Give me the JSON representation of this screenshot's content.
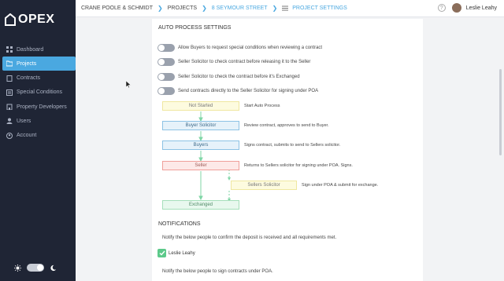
{
  "app": {
    "logo_text": "OPEX"
  },
  "sidebar": {
    "items": [
      {
        "label": "Dashboard",
        "icon": "grid-icon"
      },
      {
        "label": "Projects",
        "icon": "folder-icon",
        "active": true
      },
      {
        "label": "Contracts",
        "icon": "document-icon"
      },
      {
        "label": "Special Conditions",
        "icon": "list-icon"
      },
      {
        "label": "Property Developers",
        "icon": "building-icon"
      },
      {
        "label": "Users",
        "icon": "user-icon"
      },
      {
        "label": "Account",
        "icon": "account-icon"
      }
    ],
    "theme_toggle": {
      "light_icon": "sun-icon",
      "dark_icon": "moon-icon",
      "state": "on"
    }
  },
  "breadcrumb": {
    "items": [
      "CRANE POOLE & SCHMIDT",
      "PROJECTS",
      "8 SEYMOUR STREET",
      "PROJECT SETTINGS"
    ]
  },
  "user": {
    "name": "Leslie Leahy",
    "help_label": "?"
  },
  "auto_process": {
    "title": "AUTO PROCESS SETTINGS",
    "toggles": [
      {
        "label": "Allow Buyers to request special conditions when reviewing a contract",
        "on": false
      },
      {
        "label": "Seller Solicitor to check contract before releasing it to the Seller",
        "on": false
      },
      {
        "label": "Seller Solicitor to check the contract before it's Exchanged",
        "on": false
      },
      {
        "label": "Send contracts directly to the Seller Solicitor for signing under POA",
        "on": false
      }
    ]
  },
  "flow": {
    "steps": [
      {
        "label": "Not Started",
        "desc": "Start Auto Process",
        "color": "#fdfbdf"
      },
      {
        "label": "Buyer Solicitor",
        "desc": "Review contract, approves to send to Buyer.",
        "color": "#e6f2fa"
      },
      {
        "label": "Buyers",
        "desc": "Signs contract, submits to send to Sellers solicitor.",
        "color": "#e6f2fa"
      },
      {
        "label": "Seller",
        "desc": "Returns to Sellers solicitor for signing under POA. Signs.",
        "color": "#fde9e8"
      },
      {
        "label": "Sellers Solicitor",
        "desc": "Sign under POA & submit for exchange.",
        "color": "#fdfbdf"
      },
      {
        "label": "Exchanged",
        "desc": "",
        "color": "#e8f8ee"
      }
    ]
  },
  "notifications": {
    "title": "NOTIFICATIONS",
    "deposit_text": "Notify the below people to confirm the deposit is received and all requirements met.",
    "deposit_people": [
      {
        "name": "Leslie Leahy",
        "checked": true
      }
    ],
    "poa_text": "Notify the below people to sign contracts under POA."
  },
  "colors": {
    "sidebar_bg": "#1f2535",
    "accent": "#4aa8e0",
    "success": "#5cc98a"
  }
}
